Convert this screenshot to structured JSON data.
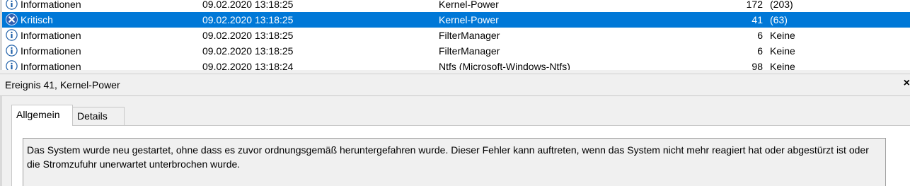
{
  "events": [
    {
      "level": "Informationen",
      "datetime": "09.02.2020 13:18:25",
      "source": "Kernel-Power",
      "event_id": "172",
      "task": "(203)",
      "icon": "info-icon",
      "selected": false
    },
    {
      "level": "Kritisch",
      "datetime": "09.02.2020 13:18:25",
      "source": "Kernel-Power",
      "event_id": "41",
      "task": "(63)",
      "icon": "critical-icon",
      "selected": true
    },
    {
      "level": "Informationen",
      "datetime": "09.02.2020 13:18:25",
      "source": "FilterManager",
      "event_id": "6",
      "task": "Keine",
      "icon": "info-icon",
      "selected": false
    },
    {
      "level": "Informationen",
      "datetime": "09.02.2020 13:18:25",
      "source": "FilterManager",
      "event_id": "6",
      "task": "Keine",
      "icon": "info-icon",
      "selected": false
    },
    {
      "level": "Informationen",
      "datetime": "09.02.2020 13:18:24",
      "source": "Ntfs (Microsoft-Windows-Ntfs)",
      "event_id": "98",
      "task": "Keine",
      "icon": "info-icon",
      "selected": false
    }
  ],
  "detail": {
    "title": "Ereignis 41, Kernel-Power",
    "close": "×",
    "tabs": [
      "Allgemein",
      "Details"
    ],
    "description": "Das System wurde neu gestartet, ohne dass es zuvor ordnungsgemäß heruntergefahren wurde. Dieser Fehler kann auftreten, wenn das System nicht mehr reagiert hat oder abgestürzt ist oder die Stromzufuhr unerwartet unterbrochen wurde."
  },
  "colors": {
    "selection": "#0078d7",
    "info_icon": "#1e5fa8",
    "critical_icon": "#3a6fd1"
  }
}
